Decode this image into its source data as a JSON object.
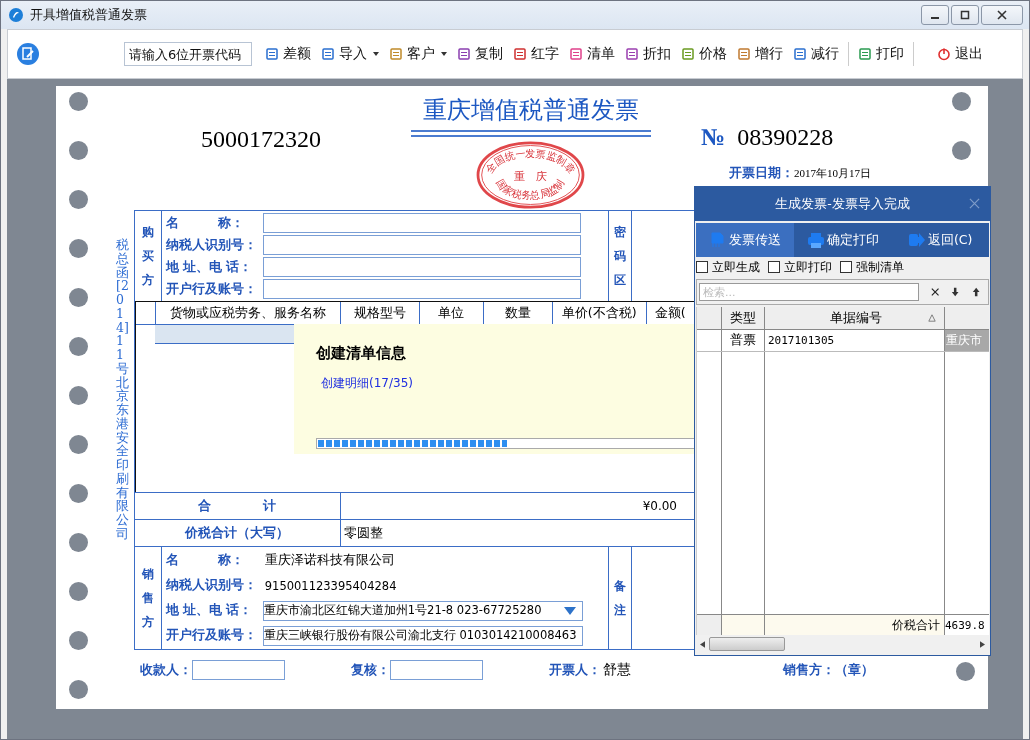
{
  "window": {
    "title": "开具增值税普通发票"
  },
  "toolbar": {
    "code_field": {
      "placeholder": "请输入6位开票代码"
    },
    "buttons": [
      {
        "label": "差额",
        "kind": "plain"
      },
      {
        "label": "导入",
        "kind": "dropdown"
      },
      {
        "label": "客户",
        "kind": "dropdown"
      },
      {
        "label": "复制",
        "kind": "plain"
      },
      {
        "label": "红字",
        "kind": "plain"
      },
      {
        "label": "清单",
        "kind": "plain"
      },
      {
        "label": "折扣",
        "kind": "plain"
      },
      {
        "label": "价格",
        "kind": "plain"
      },
      {
        "label": "增行",
        "kind": "plain"
      },
      {
        "label": "减行",
        "kind": "plain"
      },
      {
        "label": "打印",
        "kind": "plain"
      },
      {
        "label": "退出",
        "kind": "exit"
      }
    ]
  },
  "invoice": {
    "code": "5000172320",
    "title": "重庆增值税普通发票",
    "stamp": {
      "top": "全国统一发票监制章",
      "middle": "重　庆",
      "bottom": "国家税务总局监制"
    },
    "number_mark": "№",
    "number": "08390228",
    "date_label": "开票日期：",
    "date": "2017年10月17日",
    "side_note": "税总函[2014]11号北京东港安全印刷有限公司",
    "buyer": {
      "section": "购买方",
      "fields": [
        {
          "label": "名　　　称："
        },
        {
          "label": "纳税人识别号："
        },
        {
          "label": "地 址、电 话："
        },
        {
          "label": "开户行及账号："
        }
      ]
    },
    "password_area": "密码区",
    "items": {
      "columns": [
        "货物或应税劳务、服务名称",
        "规格型号",
        "单位",
        "数量",
        "单价(不含税)",
        "金额("
      ]
    },
    "total": {
      "label": "合　　　　计",
      "amount": "¥0.00"
    },
    "total_words": {
      "label": "价税合计（大写）",
      "value": "零圆整"
    },
    "seller": {
      "section": "销售方",
      "name_label": "名　　　称：",
      "name": "重庆泽诺科技有限公司",
      "id_label": "纳税人识别号：",
      "id": "915001123395404284",
      "address_label": "地 址、电 话：",
      "address": "重庆市渝北区红锦大道加州1号21-8  023-67725280",
      "bank_label": "开户行及账号：",
      "bank": "重庆三峡银行股份有限公司渝北支行  0103014210008463"
    },
    "remarks": "备注",
    "signatures": {
      "payee_label": "收款人：",
      "reviewer_label": "复核：",
      "drawer_label": "开票人：",
      "drawer": "舒慧",
      "seller_seal": "销售方：（章）"
    }
  },
  "progress": {
    "title": "创建清单信息",
    "status": "创建明细(17/35)",
    "level": 0.49
  },
  "dialog": {
    "title": "生成发票-发票导入完成",
    "actions": [
      {
        "label": "发票传送",
        "selected": true
      },
      {
        "label": "确定打印",
        "selected": false
      },
      {
        "label": "返回(C)",
        "selected": false
      }
    ],
    "options": [
      {
        "label": "立即生成",
        "checked": false
      },
      {
        "label": "立即打印",
        "checked": false
      },
      {
        "label": "强制清单",
        "checked": false
      }
    ],
    "search": {
      "placeholder": "检索..."
    },
    "grid": {
      "columns": [
        "类型",
        "单据编号"
      ],
      "rows": [
        {
          "type": "普票",
          "number": "2017101305",
          "column_4": "重庆市"
        }
      ],
      "footer": {
        "label": "价税合计",
        "value": "4639.8"
      }
    }
  }
}
